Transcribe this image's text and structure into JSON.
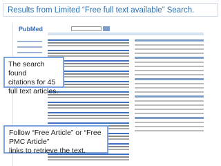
{
  "title": "Results from Limited “Free full text available” Search.",
  "callout_search": {
    "line1": "The search found",
    "line2": "citations for 45",
    "line3": "full text articles."
  },
  "callout_follow": {
    "line1": "Follow “Free Article” or “Free PMC Article”",
    "line2": "links to retrieve the text."
  },
  "screenshot": {
    "logo": "PubMed"
  },
  "colors": {
    "title_text": "#2a6fb0",
    "callout_border": "#7aa3e0"
  }
}
